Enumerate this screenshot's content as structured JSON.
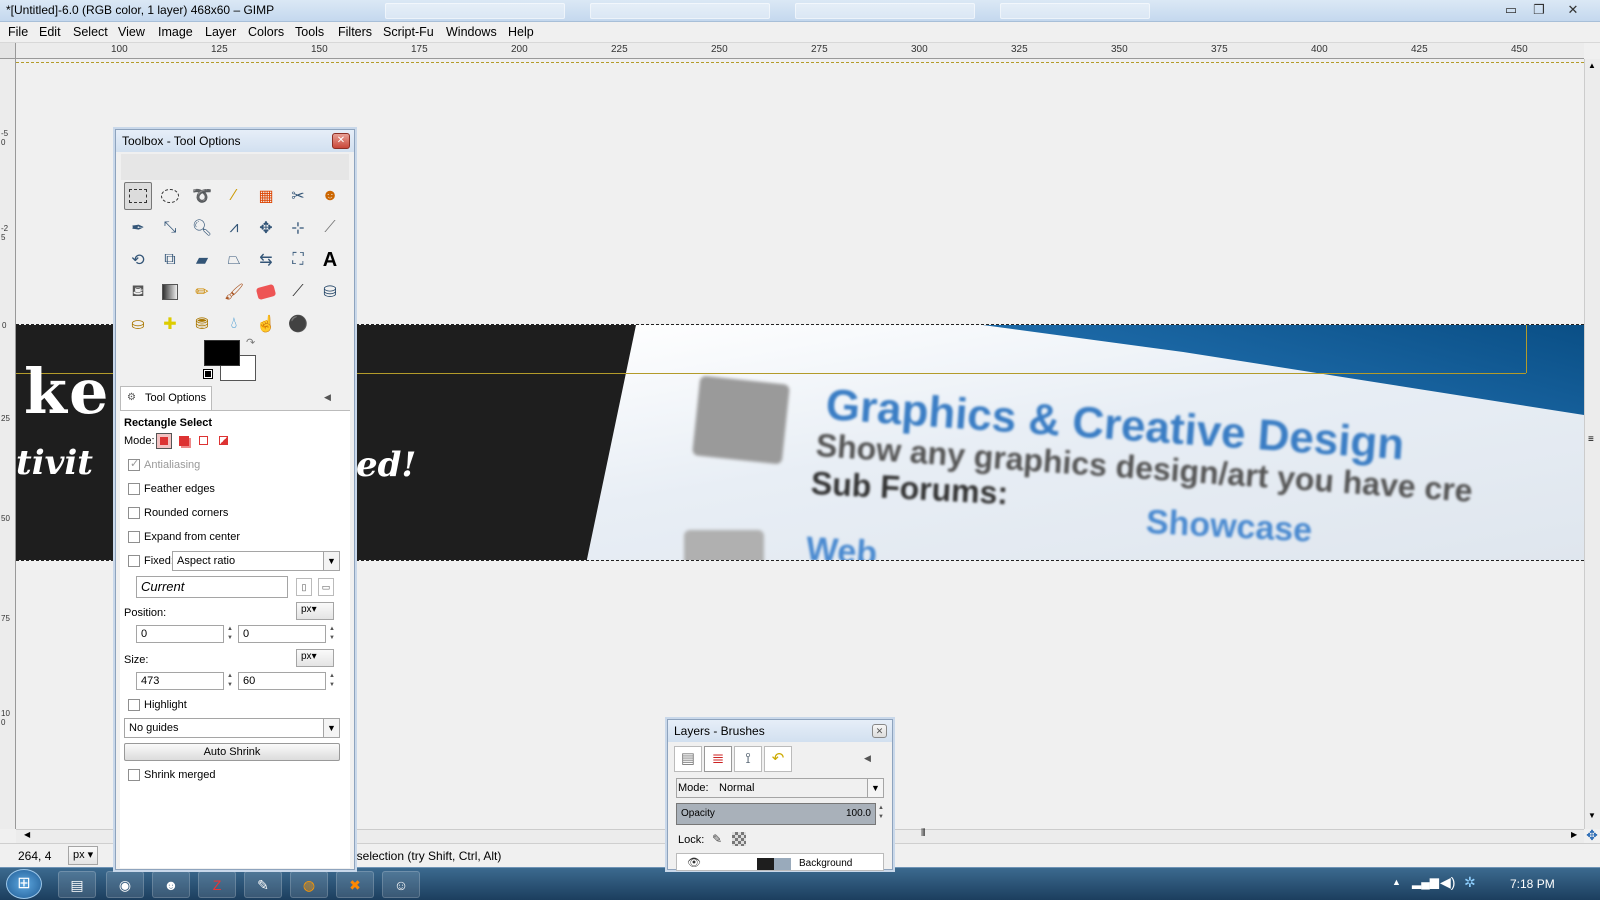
{
  "window": {
    "title": "*[Untitled]-6.0 (RGB color, 1 layer) 468x60 – GIMP",
    "minimize_label": "▭",
    "restore_label": "❐",
    "close_label": "✕"
  },
  "menu": [
    "File",
    "Edit",
    "Select",
    "View",
    "Image",
    "Layer",
    "Colors",
    "Tools",
    "Filters",
    "Script-Fu",
    "Windows",
    "Help"
  ],
  "ruler": {
    "h_ticks": [
      "100",
      "125",
      "150",
      "175",
      "200",
      "225",
      "250",
      "275",
      "300",
      "325",
      "350",
      "375",
      "400",
      "425",
      "450"
    ],
    "v_ticks": [
      "-50",
      "-25",
      "0",
      "25",
      "50",
      "75",
      "100"
    ]
  },
  "canvas_text": {
    "left_big": "ke:",
    "left_sub": "tivit",
    "left_sub2": "ed!",
    "heading": "Graphics & Creative Design",
    "subline": "Show any graphics design/art you have cre",
    "subforums": "Sub Forums:",
    "showcase": "Showcase",
    "bottom": "Web"
  },
  "toolbox": {
    "title": "Toolbox - Tool Options",
    "close_label": "✕",
    "tools": [
      "rect-select",
      "ellipse-select",
      "free-select",
      "fuzzy-select",
      "select-by-color",
      "scissors",
      "foreground-select",
      "paths",
      "color-picker",
      "zoom",
      "measure",
      "move",
      "align",
      "crop",
      "rotate",
      "scale",
      "shear",
      "perspective",
      "flip",
      "cage",
      "text",
      "bucket-fill",
      "blend",
      "pencil",
      "paintbrush",
      "eraser",
      "airbrush",
      "ink",
      "clone",
      "heal",
      "perspective-clone",
      "blur",
      "smudge",
      "dodge-burn"
    ],
    "tab_label": "Tool Options",
    "tool_name": "Rectangle Select",
    "mode_label": "Mode:",
    "antialiasing": "Antialiasing",
    "feather": "Feather edges",
    "rounded": "Rounded corners",
    "expand": "Expand from center",
    "fixed": "Fixed:",
    "fixed_value": "Aspect ratio",
    "current_value": "Current",
    "position_label": "Position:",
    "position_unit": "px",
    "pos_x": "0",
    "pos_y": "0",
    "size_label": "Size:",
    "size_unit": "px",
    "size_w": "473",
    "size_h": "60",
    "highlight": "Highlight",
    "guides_value": "No guides",
    "auto_shrink": "Auto Shrink",
    "shrink_merged": "Shrink merged"
  },
  "layers": {
    "title": "Layers - Brushes",
    "close_label": "✕",
    "mode_label": "Mode:",
    "mode_value": "Normal",
    "opacity_label": "Opacity",
    "opacity_value": "100.0",
    "lock_label": "Lock:",
    "layer_name": "Background"
  },
  "status": {
    "coords": "264, 4",
    "unit": "px",
    "message": "t selection (try Shift, Ctrl, Alt)"
  },
  "taskbar": {
    "clock": "7:18 PM"
  },
  "colors": {
    "fg": "#000000",
    "bg": "#ffffff"
  }
}
